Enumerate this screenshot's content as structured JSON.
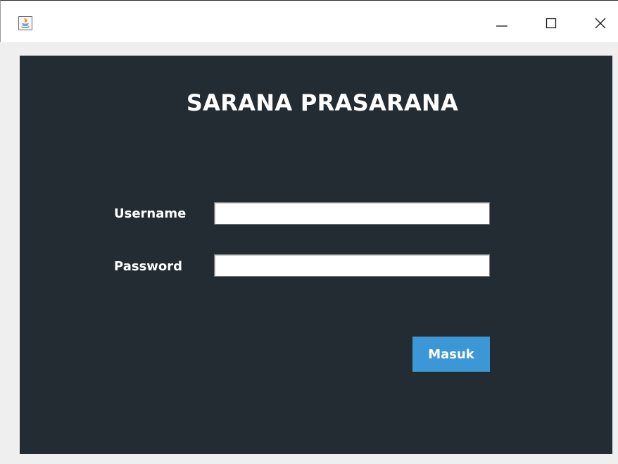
{
  "window": {
    "title": "",
    "app_icon": "java-icon",
    "controls": {
      "minimize_icon": "minimize-icon",
      "maximize_icon": "maximize-icon",
      "close_icon": "close-icon"
    }
  },
  "form": {
    "title": "SARANA PRASARANA",
    "username_label": "Username",
    "username_value": "",
    "password_label": "Password",
    "password_value": "",
    "submit_label": "Masuk"
  },
  "colors": {
    "panel_background": "#232c32",
    "submit_button": "#3b97d5",
    "text": "#ffffff"
  }
}
